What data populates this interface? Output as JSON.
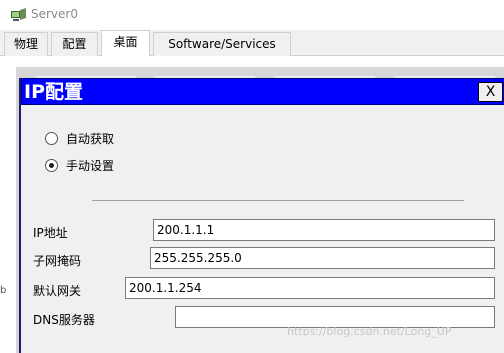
{
  "window": {
    "title": "Server0",
    "icon": "server-icon"
  },
  "tabs": [
    {
      "label": "物理",
      "active": false
    },
    {
      "label": "配置",
      "active": false
    },
    {
      "label": "桌面",
      "active": true
    },
    {
      "label": "Software/Services",
      "active": false
    }
  ],
  "dialog": {
    "title": "IP配置",
    "close_label": "X",
    "radio_dhcp": {
      "label": "自动获取",
      "checked": false
    },
    "radio_static": {
      "label": "手动设置",
      "checked": true
    },
    "fields": [
      {
        "label": "IP地址",
        "value": "200.1.1.1"
      },
      {
        "label": "子网掩码",
        "value": "255.255.255.0"
      },
      {
        "label": "默认网关",
        "value": "200.1.1.254"
      },
      {
        "label": "DNS服务器",
        "value": ""
      }
    ]
  },
  "edge_mark": "b",
  "watermark": "https://blog.csdn.net/Long_UP",
  "colors": {
    "dialog_title": "#0000ff",
    "dialog_bg": "#f0f0f0"
  }
}
